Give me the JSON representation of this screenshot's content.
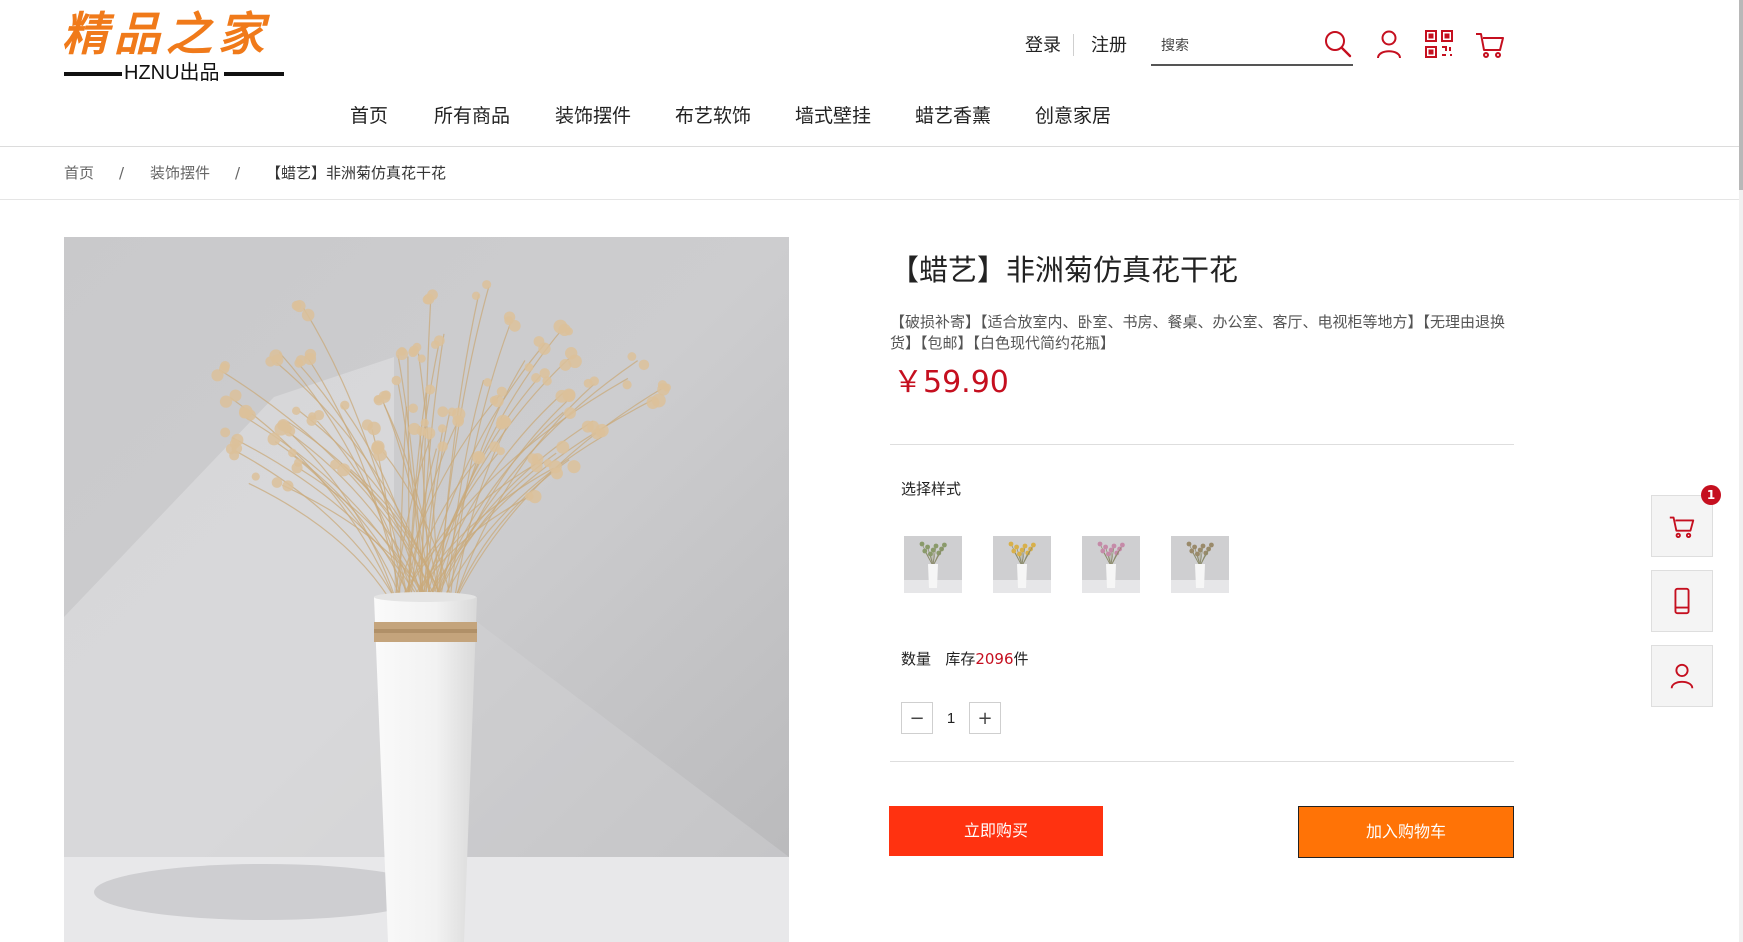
{
  "logo": {
    "title": "精品之家",
    "subtitle": "HZNU出品"
  },
  "header": {
    "login": "登录",
    "register": "注册",
    "search_placeholder": "搜索",
    "icons": [
      "search-icon",
      "user-icon",
      "qrcode-icon",
      "cart-icon"
    ]
  },
  "nav": {
    "items": [
      {
        "label": "首页"
      },
      {
        "label": "所有商品"
      },
      {
        "label": "装饰摆件"
      },
      {
        "label": "布艺软饰"
      },
      {
        "label": "墙式壁挂"
      },
      {
        "label": "蜡艺香薰"
      },
      {
        "label": "创意家居"
      }
    ]
  },
  "breadcrumb": {
    "items": [
      "首页",
      "装饰摆件",
      "【蜡艺】非洲菊仿真花干花"
    ],
    "separator": "/"
  },
  "product": {
    "title": "【蜡艺】非洲菊仿真花干花",
    "description": "【破损补寄】【适合放室内、卧室、书房、餐桌、办公室、客厅、电视柜等地方】【无理由退换货】【包邮】【白色现代简约花瓶】",
    "price": "￥59.90",
    "style_label": "选择样式",
    "styles": [
      {
        "name": "style-1",
        "flower_color": "#8a9a6a"
      },
      {
        "name": "style-2",
        "flower_color": "#d8b04a"
      },
      {
        "name": "style-3",
        "flower_color": "#c58aa8"
      },
      {
        "name": "style-4",
        "flower_color": "#9a8a6a"
      }
    ],
    "quantity_label": "数量",
    "stock_prefix": "库存",
    "stock_count": "2096",
    "stock_suffix": "件",
    "quantity": "1",
    "minus": "−",
    "plus": "+",
    "buy_now": "立即购买",
    "add_to_cart": "加入购物车"
  },
  "sidebar": {
    "cart_badge": "1",
    "icons": [
      "cart-icon",
      "phone-icon",
      "user-icon"
    ]
  },
  "colors": {
    "brand_orange": "#f07a1a",
    "price_red": "#c50f1f",
    "buy_button": "#ff3210",
    "cart_button": "#ff7306"
  }
}
